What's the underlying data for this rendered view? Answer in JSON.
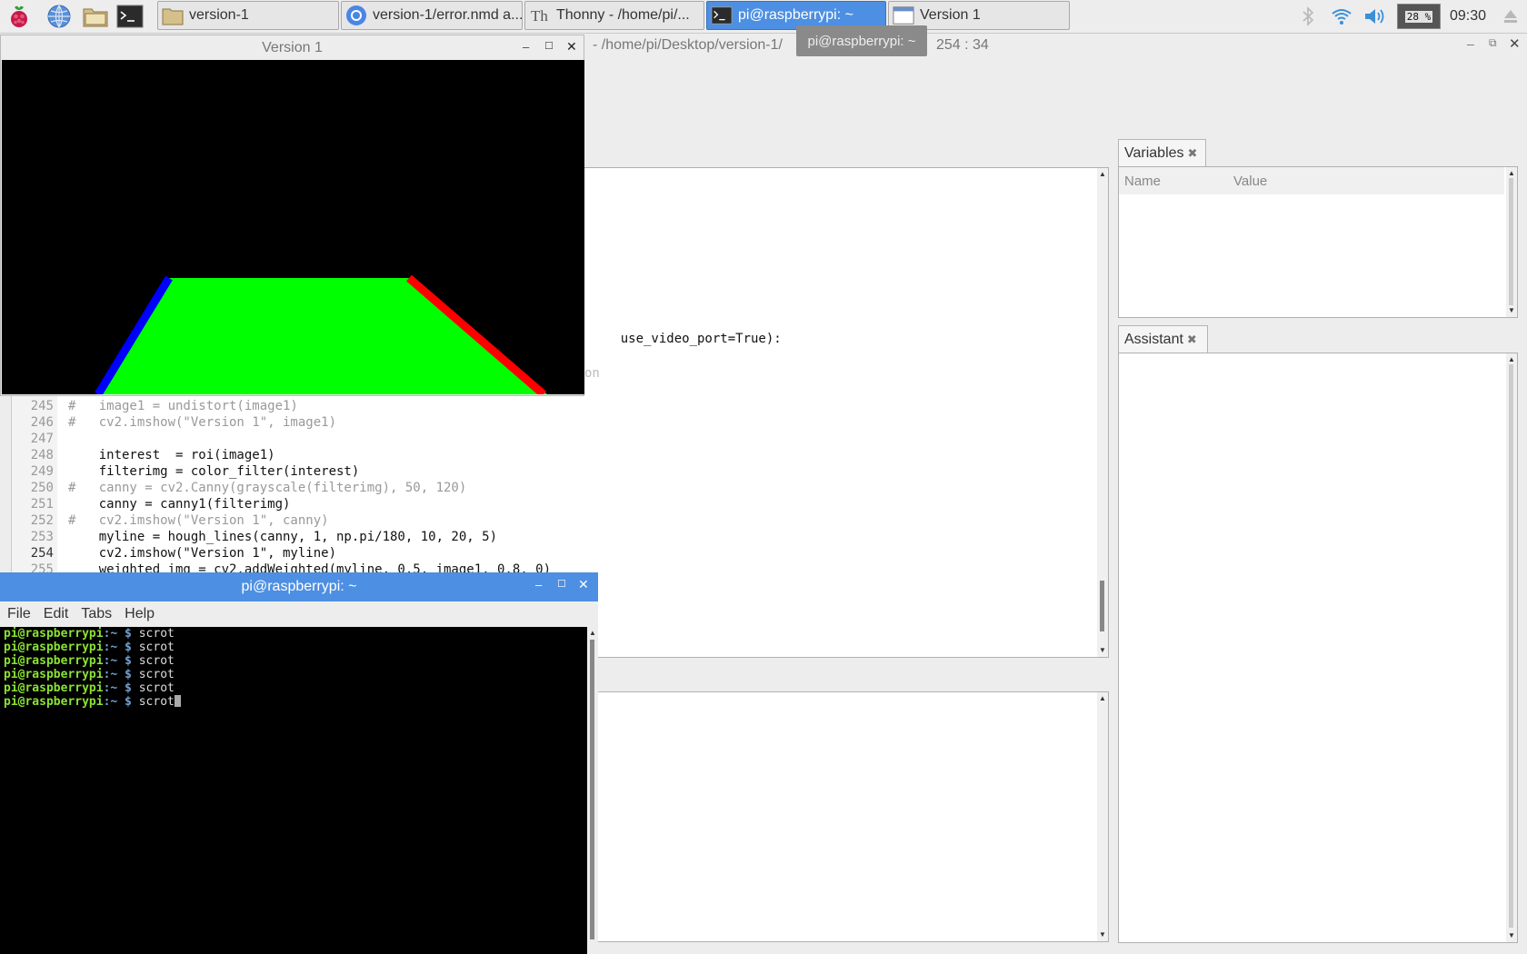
{
  "taskbar": {
    "tasks": [
      {
        "label": "version-1",
        "icon": "folder-icon"
      },
      {
        "label": "version-1/error.nmd a...",
        "icon": "chromium-icon"
      },
      {
        "label": "Thonny  -  /home/pi/...",
        "icon": "thonny-icon"
      },
      {
        "label": "pi@raspberrypi: ~",
        "icon": "terminal-icon",
        "active": true
      },
      {
        "label": "Version 1",
        "icon": "window-icon"
      }
    ],
    "cpu": "28 %",
    "clock": "09:30",
    "tooltip": "pi@raspberrypi: ~"
  },
  "thonny": {
    "title_path": "-  /home/pi/Desktop/version-1/",
    "cursor_pos": "254 : 34",
    "partial_line1": "use_video_port=True):",
    "partial_line2": "on",
    "code_lines": [
      {
        "num": "245",
        "text": "#   image1 = undistort(image1)"
      },
      {
        "num": "246",
        "text": "#   cv2.imshow(\"Version 1\", image1)"
      },
      {
        "num": "247",
        "text": ""
      },
      {
        "num": "248",
        "text": "    interest  = roi(image1)"
      },
      {
        "num": "249",
        "text": "    filterimg = color_filter(interest)"
      },
      {
        "num": "250",
        "text": "#   canny = cv2.Canny(grayscale(filterimg), 50, 120)"
      },
      {
        "num": "251",
        "text": "    canny = canny1(filterimg)"
      },
      {
        "num": "252",
        "text": "#   cv2.imshow(\"Version 1\", canny)"
      },
      {
        "num": "253",
        "text": "    myline = hough_lines(canny, 1, np.pi/180, 10, 20, 5)"
      },
      {
        "num": "254",
        "text": "    cv2.imshow(\"Version 1\", myline)"
      },
      {
        "num": "255",
        "text": "    weighted_img = cv2.addWeighted(myline, 0.5, image1, 0.8, 0)"
      }
    ],
    "variables_tab": "Variables",
    "variables_headers": [
      "Name",
      "Value"
    ],
    "assistant_tab": "Assistant"
  },
  "version_window": {
    "title": "Version 1"
  },
  "terminal": {
    "title": "pi@raspberrypi: ~",
    "menu": [
      "File",
      "Edit",
      "Tabs",
      "Help"
    ],
    "prompt_user": "pi@raspberrypi",
    "prompt_path": ":~",
    "prompt_sign": " $",
    "command": " scrot",
    "line_count": 6
  },
  "colors": {
    "accent": "#4d8fe2",
    "lane_fill": "#00ff00",
    "left_line": "#0000ff",
    "right_line": "#ff0000",
    "prompt_green": "#8ae234",
    "prompt_blue": "#729fcf"
  }
}
